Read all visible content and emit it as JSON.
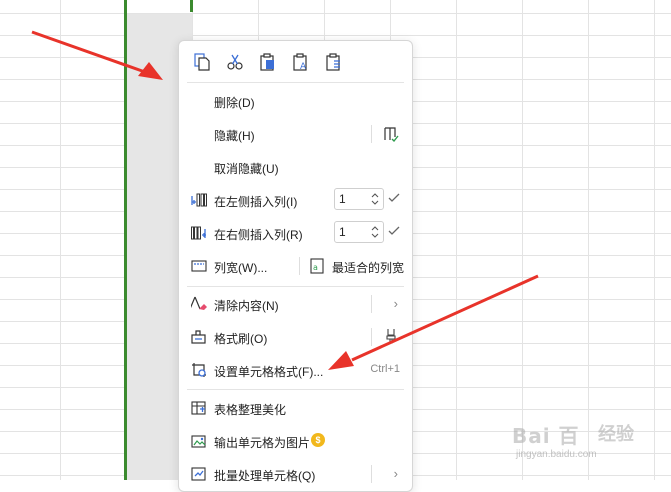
{
  "toolbar": {
    "icons": [
      "copy-icon",
      "cut-icon",
      "paste-icon",
      "paste-format-icon",
      "paste-special-icon"
    ]
  },
  "menu": {
    "delete": "删除(D)",
    "hide": "隐藏(H)",
    "unhide": "取消隐藏(U)",
    "insert_left": "在左侧插入列(I)",
    "insert_left_value": "1",
    "insert_right": "在右侧插入列(R)",
    "insert_right_value": "1",
    "column_width": "列宽(W)...",
    "best_fit": "最适合的列宽",
    "clear_content": "清除内容(N)",
    "format_painter": "格式刷(O)",
    "format_cells": "设置单元格格式(F)...",
    "format_cells_shortcut": "Ctrl+1",
    "beautify": "表格整理美化",
    "export_image": "输出单元格为图片",
    "batch_process": "批量处理单元格(Q)"
  },
  "watermark": {
    "logo": "Bai 百",
    "brand": "经验",
    "url": "jingyan.baidu.com"
  },
  "colors": {
    "selection_border": "#3b8a2e",
    "arrow": "#e8332a",
    "coin": "#f2b81c"
  }
}
